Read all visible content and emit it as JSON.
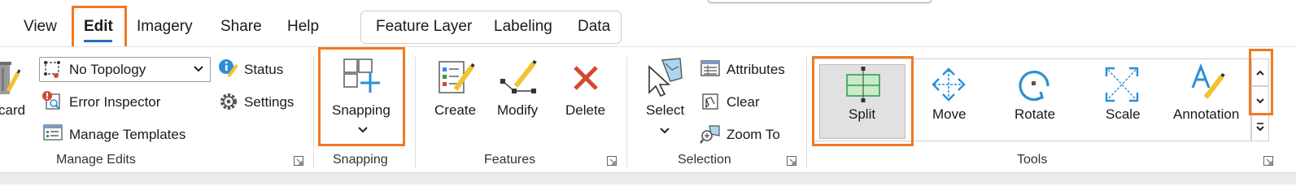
{
  "tabs": [
    "View",
    "Edit",
    "Imagery",
    "Share",
    "Help"
  ],
  "contextual_tabs": [
    "Feature Layer",
    "Labeling",
    "Data"
  ],
  "manage_edits": {
    "discard_label": "card",
    "topology_select": "No Topology",
    "status_label": "Status",
    "error_inspector_label": "Error Inspector",
    "settings_label": "Settings",
    "manage_templates_label": "Manage Templates",
    "group_label": "Manage Edits"
  },
  "snapping": {
    "button_label": "Snapping",
    "group_label": "Snapping"
  },
  "features": {
    "create_label": "Create",
    "modify_label": "Modify",
    "delete_label": "Delete",
    "group_label": "Features"
  },
  "selection": {
    "select_label": "Select",
    "attributes_label": "Attributes",
    "clear_label": "Clear",
    "zoom_to_label": "Zoom To",
    "group_label": "Selection"
  },
  "tools": {
    "items": [
      "Split",
      "Move",
      "Rotate",
      "Scale",
      "Annotation"
    ],
    "group_label": "Tools"
  },
  "colors": {
    "highlight": "#f07a22",
    "accent_blue": "#2b8fd6",
    "delete_red": "#d24a2e",
    "pencil_yellow": "#f2c230",
    "split_green": "#3a9a4a"
  }
}
